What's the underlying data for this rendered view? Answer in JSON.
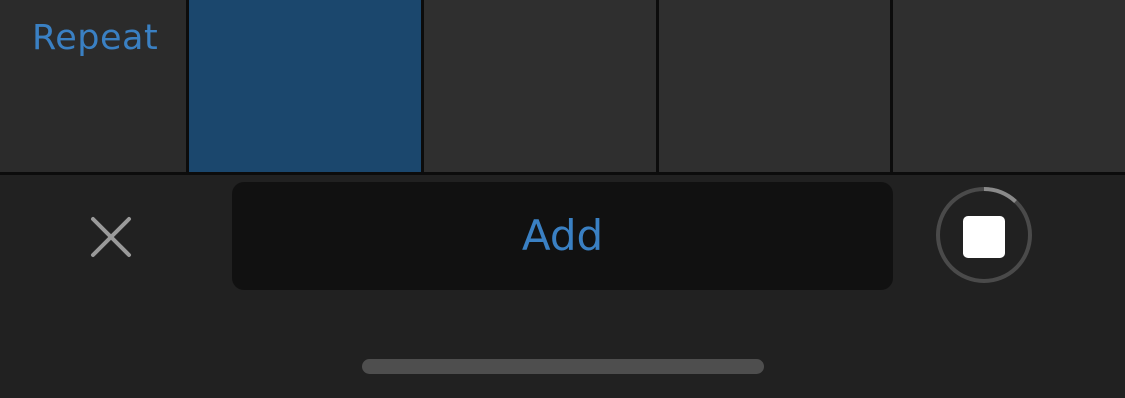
{
  "repeat_row": {
    "label": "Repeat",
    "cells": [
      {
        "selected": true
      },
      {
        "selected": false
      },
      {
        "selected": false
      },
      {
        "selected": false
      }
    ]
  },
  "toolbar": {
    "close_icon": "close-icon",
    "add_label": "Add",
    "stop_icon": "stop-icon",
    "progress": 0.12
  },
  "colors": {
    "accent": "#3a80c3",
    "selected_cell": "#1b476d",
    "background": "#212121"
  }
}
